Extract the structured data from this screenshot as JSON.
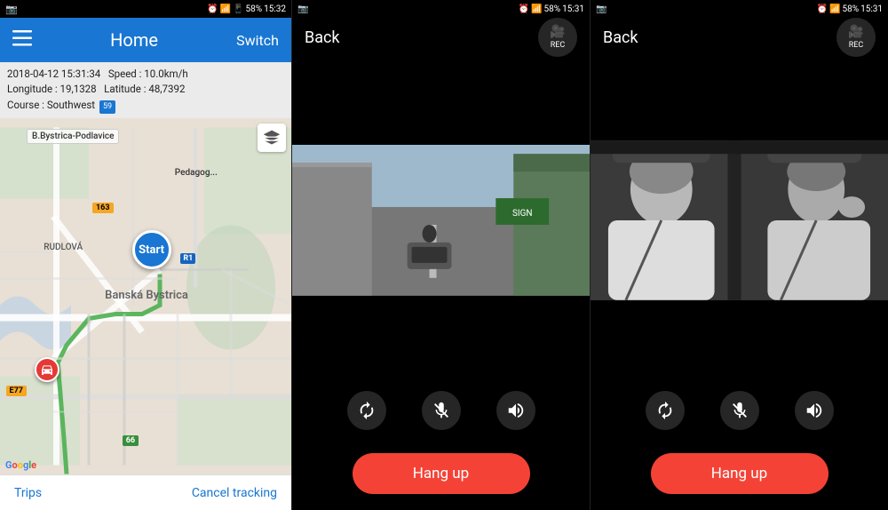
{
  "panel1": {
    "status_bar": {
      "time": "15:32",
      "battery": "58%",
      "signal": "4G"
    },
    "top_bar": {
      "menu_label": "☰",
      "title": "Home",
      "switch_label": "Switch"
    },
    "info": {
      "datetime": "2018-04-12  15:31:34",
      "speed_label": "Speed :",
      "speed_value": "10.0km/h",
      "longitude_label": "Longitude :",
      "longitude_value": "19,1328",
      "latitude_label": "Latitude :",
      "latitude_value": "48,7392",
      "course_label": "Course :",
      "course_value": "Southwest",
      "badge": "59"
    },
    "map": {
      "start_label": "Start",
      "city_label": "Banská Bystrica",
      "district_label": "RUDLOVÁ",
      "place1": "B.Bystrica-Podlavice",
      "place2": "Pedagog...",
      "road1": "163",
      "road2": "E77",
      "road3": "66",
      "road4": "R1"
    },
    "bottom": {
      "trips_label": "Trips",
      "cancel_label": "Cancel tracking"
    }
  },
  "panel2": {
    "status_bar": {
      "time": "15:31",
      "battery": "58%"
    },
    "top_bar": {
      "back_label": "Back",
      "rec_label": "REC"
    },
    "controls": {
      "rotate_label": "↺",
      "mute_label": "🎤",
      "speaker_label": "🔊"
    },
    "hangup_label": "Hang up"
  },
  "panel3": {
    "status_bar": {
      "time": "15:31",
      "battery": "58%"
    },
    "top_bar": {
      "back_label": "Back",
      "rec_label": "REC"
    },
    "controls": {
      "rotate_label": "↺",
      "mute_label": "🎤",
      "speaker_label": "🔊"
    },
    "hangup_label": "Hang up"
  }
}
